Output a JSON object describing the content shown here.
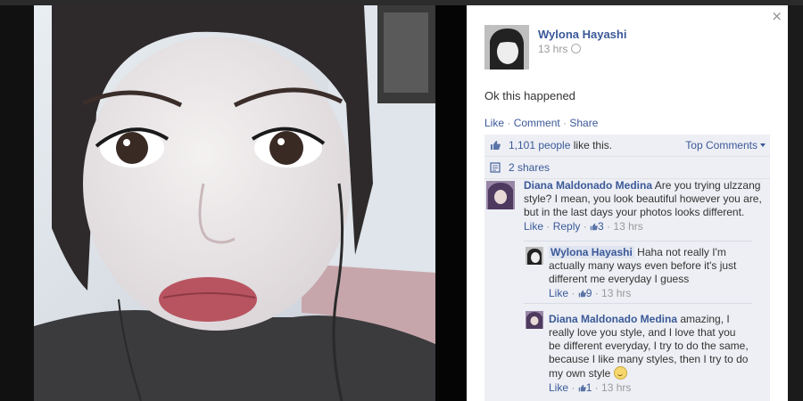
{
  "post": {
    "author": "Wylona Hayashi",
    "time": "13 hrs",
    "text": "Ok this happened",
    "actions": {
      "like": "Like",
      "comment": "Comment",
      "share": "Share"
    }
  },
  "stats": {
    "likes_count": "1,101 people",
    "likes_suffix": " like this.",
    "shares": "2 shares",
    "top_comments": "Top Comments"
  },
  "comments": [
    {
      "author": "Diana Maldonado Medina",
      "text": " Are you trying ulzzang style? I mean, you look beautiful however you are, but in the last days your photos looks different.",
      "like": "Like",
      "reply": "Reply",
      "likes": "3",
      "time": "13 hrs"
    }
  ],
  "replies": [
    {
      "author": "Wylona Hayashi",
      "text": " Haha not really I'm actually many ways even before it's just different me everyday I guess",
      "like": "Like",
      "likes": "9",
      "time": "13 hrs"
    },
    {
      "author": "Diana Maldonado Medina",
      "text": " amazing, I really love you style, and I love that you be different everyday, I try to do the same, because I like many styles, then I try to do my own style ",
      "like": "Like",
      "likes": "1",
      "time": "13 hrs"
    }
  ],
  "ui": {
    "close": "×",
    "sep": " · "
  },
  "colors": {
    "link": "#3b5998",
    "ufi_bg": "#edeff4",
    "muted": "#999999"
  },
  "icons": [
    "close-icon",
    "globe-icon",
    "like-thumb-icon",
    "share-icon",
    "smiley-icon"
  ]
}
